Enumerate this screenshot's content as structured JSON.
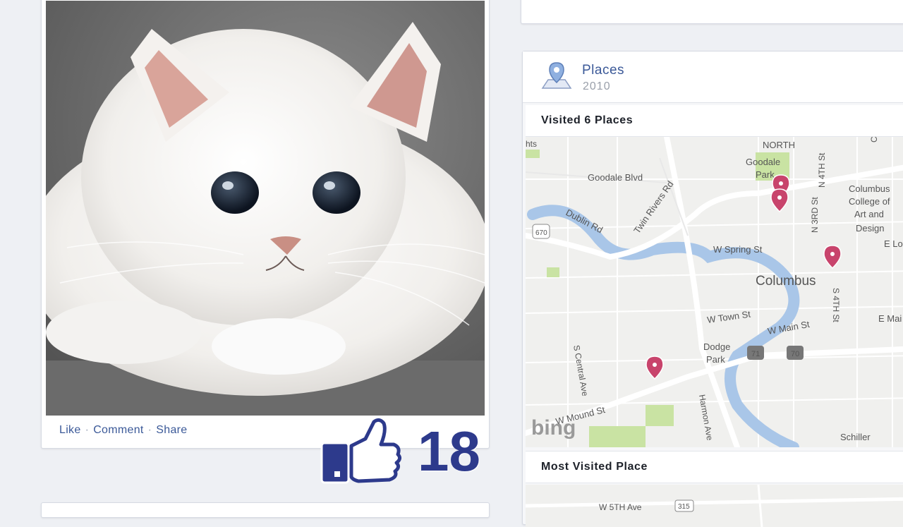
{
  "post": {
    "actions": {
      "like": "Like",
      "comment": "Comment",
      "share": "Share",
      "separator": "·"
    },
    "like_count": "18"
  },
  "places": {
    "title": "Places",
    "year": "2010",
    "visited_label": "Visited 6 Places",
    "most_visited_label": "Most Visited Place",
    "map": {
      "labels": {
        "hts": "hts",
        "north": "NORTH",
        "goodale_blvd": "Goodale Blvd",
        "goodale_park": "Goodale",
        "goodale_park2": "Park",
        "dublin_rd": "Dublin Rd",
        "twin_rivers": "Twin Rivers Rd",
        "spring": "W Spring St",
        "columbus": "Columbus",
        "ccad1": "Columbus",
        "ccad2": "College of",
        "ccad3": "Art and",
        "ccad4": "Design",
        "elong": "E Long",
        "n3rd": "N 3RD St",
        "n4th": "N 4TH St",
        "s4th": "S 4TH St",
        "town": "W Town St",
        "main": "W Main St",
        "emain": "E Mai",
        "dodge1": "Dodge",
        "dodge2": "Park",
        "central": "S Central Ave",
        "mound": "W Mound St",
        "harmon": "Harmon Ave",
        "schiller": "Schiller",
        "cle": "Cle",
        "r670": "670",
        "r71": "71",
        "r70": "70",
        "bing": "bing",
        "w5th": "W 5TH Ave",
        "r315": "315"
      }
    }
  },
  "colors": {
    "link": "#3b5998",
    "like_blue": "#2d3a8c",
    "pin": "#c8446c",
    "water": "#a9c6e8",
    "park": "#c9e3a3"
  }
}
